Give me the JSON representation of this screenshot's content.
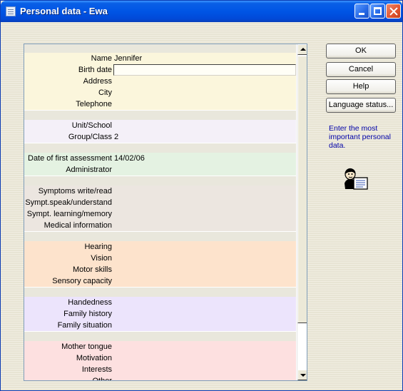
{
  "window": {
    "title": "Personal data - Ewa"
  },
  "form": {
    "groups": [
      {
        "color": "#fbf6dc",
        "rows": [
          {
            "label": "Name",
            "value": "Jennifer"
          },
          {
            "label": "Birth date",
            "value": "",
            "focused": true
          },
          {
            "label": "Address",
            "value": ""
          },
          {
            "label": "City",
            "value": ""
          },
          {
            "label": "Telephone",
            "value": ""
          }
        ]
      },
      {
        "color": "#f4f0f8",
        "rows": [
          {
            "label": "Unit/School",
            "value": ""
          },
          {
            "label": "Group/Class",
            "value": "2"
          }
        ]
      },
      {
        "color": "#e4f2e2",
        "rows": [
          {
            "label": "Date of first assessment",
            "value": "14/02/06"
          },
          {
            "label": "Administrator",
            "value": ""
          }
        ]
      },
      {
        "color": "#ece6e0",
        "rows": [
          {
            "label": "Symptoms write/read",
            "value": ""
          },
          {
            "label": "Sympt.speak/understand",
            "value": ""
          },
          {
            "label": "Sympt. learning/memory",
            "value": ""
          },
          {
            "label": "Medical information",
            "value": ""
          }
        ]
      },
      {
        "color": "#fde3cc",
        "rows": [
          {
            "label": "Hearing",
            "value": ""
          },
          {
            "label": "Vision",
            "value": ""
          },
          {
            "label": "Motor skills",
            "value": ""
          },
          {
            "label": "Sensory capacity",
            "value": ""
          }
        ]
      },
      {
        "color": "#ece4fc",
        "rows": [
          {
            "label": "Handedness",
            "value": ""
          },
          {
            "label": "Family history",
            "value": ""
          },
          {
            "label": "Family situation",
            "value": ""
          }
        ]
      },
      {
        "color": "#fde0e0",
        "rows": [
          {
            "label": "Mother tongue",
            "value": ""
          },
          {
            "label": "Motivation",
            "value": ""
          },
          {
            "label": "Interests",
            "value": ""
          },
          {
            "label": "Other",
            "value": ""
          }
        ]
      }
    ]
  },
  "buttons": {
    "ok": "OK",
    "cancel": "Cancel",
    "help": "Help",
    "language_status": "Language status..."
  },
  "hint": "Enter the most important personal data.",
  "icons": {
    "title": "document-icon",
    "assistant": "person-reading-icon"
  }
}
